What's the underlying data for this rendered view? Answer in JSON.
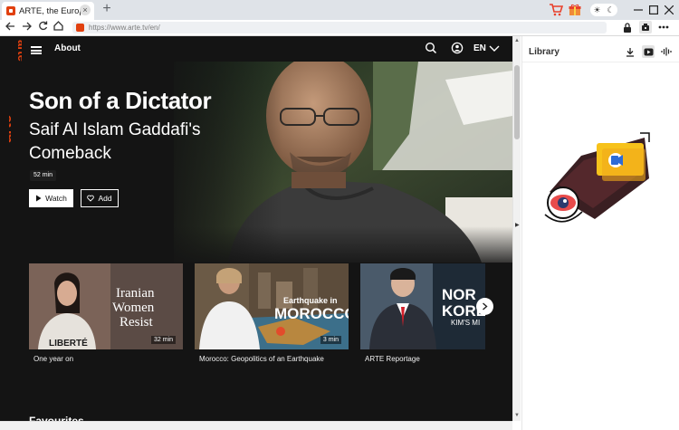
{
  "browser": {
    "tab_title": "ARTE, the European c",
    "tab_close": "×",
    "new_tab": "+",
    "url": "https://www.arte.tv/en/",
    "theme_sun": "☀",
    "theme_moon": "☾"
  },
  "site": {
    "logo_text": "arte",
    "nav_about": "About",
    "language": "EN"
  },
  "hero": {
    "logo_text": "arte",
    "title": "Son of a Dictator",
    "subtitle": "Saif Al Islam Gaddafi's Comeback",
    "duration": "52 min",
    "watch_label": "Watch",
    "add_label": "Add"
  },
  "cards": [
    {
      "label": "One year on",
      "duration": "32 min",
      "overlay_lines": [
        "Iranian",
        "Women",
        "Resist"
      ],
      "shirt_text": "LIBERTÉ"
    },
    {
      "label": "Morocco: Geopolitics of an Earthquake",
      "duration": "3 min",
      "overlay_small": "Earthquake in",
      "overlay_big": "MOROCCO"
    },
    {
      "label": "ARTE Reportage",
      "overlay_lines": [
        "NOR",
        "KORE"
      ],
      "overlay_small": "KIM'S MI"
    }
  ],
  "section": {
    "title": "Favourites"
  },
  "library": {
    "title": "Library"
  },
  "colors": {
    "arte_orange": "#e1400f",
    "page_bg": "#141414",
    "library_yellow": "#f7c21b"
  },
  "icons": {
    "back": "arrow-left",
    "forward": "arrow-right",
    "reload": "reload",
    "home": "home",
    "search": "search",
    "account": "user-circle",
    "download": "download",
    "video": "video",
    "audio": "waveform"
  }
}
